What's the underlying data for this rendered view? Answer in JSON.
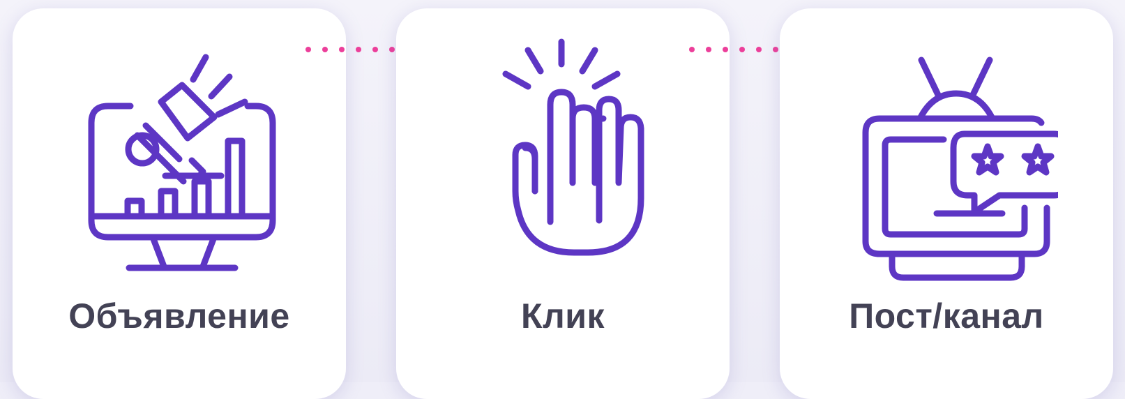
{
  "steps": [
    {
      "label": "Объявление",
      "icon": "ad-monitor-megaphone-icon"
    },
    {
      "label": "Клик",
      "icon": "click-finger-icon"
    },
    {
      "label": "Пост/канал",
      "icon": "tv-post-channel-icon"
    }
  ],
  "colors": {
    "icon_stroke": "#5d36c4",
    "arrow": "#ec3f9a",
    "text": "#434255",
    "card": "#ffffff",
    "background": "#efeef8"
  }
}
